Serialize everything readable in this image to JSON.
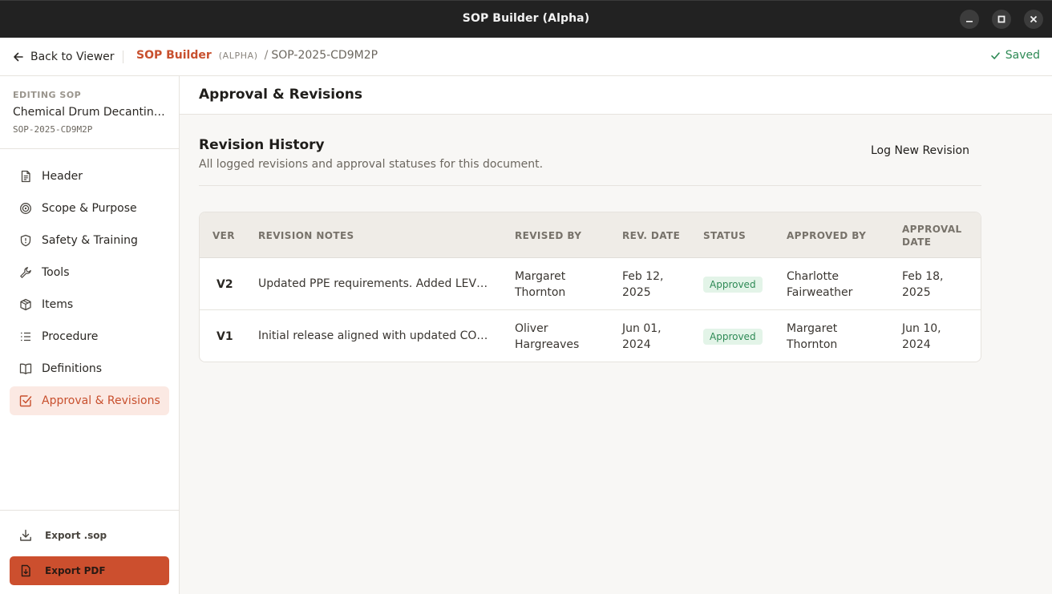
{
  "window": {
    "title": "SOP Builder (Alpha)"
  },
  "appbar": {
    "back_label": "Back to Viewer",
    "brand": "SOP Builder",
    "alpha": "(ALPHA)",
    "slash": "/",
    "doc_id": "SOP-2025-CD9M2P",
    "saved_label": "Saved"
  },
  "sidebar": {
    "editing_label": "EDITING SOP",
    "sop_name": "Chemical Drum Decanting a...",
    "sop_code": "SOP-2025-CD9M2P",
    "items": [
      {
        "label": "Header",
        "icon": "document-icon"
      },
      {
        "label": "Scope & Purpose",
        "icon": "target-icon"
      },
      {
        "label": "Safety & Training",
        "icon": "shield-icon"
      },
      {
        "label": "Tools",
        "icon": "wrench-icon"
      },
      {
        "label": "Items",
        "icon": "box-icon"
      },
      {
        "label": "Procedure",
        "icon": "list-icon"
      },
      {
        "label": "Definitions",
        "icon": "book-icon"
      },
      {
        "label": "Approval & Revisions",
        "icon": "check-square-icon",
        "active": true
      }
    ],
    "export_sop": "Export .sop",
    "export_pdf": "Export PDF"
  },
  "main": {
    "page_title": "Approval & Revisions",
    "section_title": "Revision History",
    "section_sub": "All logged revisions and approval statuses for this document.",
    "log_button": "Log New Revision",
    "columns": [
      "VER",
      "REVISION NOTES",
      "REVISED BY",
      "REV. DATE",
      "STATUS",
      "APPROVED BY",
      "APPROVAL DATE"
    ],
    "rows": [
      {
        "ver": "V2",
        "notes": "Updated PPE requirements. Added LEV reference and revised spill kit procedures.",
        "revised_by": "Margaret Thornton",
        "rev_date": "Feb 12, 2025",
        "status": "Approved",
        "approved_by": "Charlotte Fairweather",
        "approval_date": "Feb 18, 2025"
      },
      {
        "ver": "V1",
        "notes": "Initial release aligned with updated COSHH assessment.",
        "revised_by": "Oliver Hargreaves",
        "rev_date": "Jun 01, 2024",
        "status": "Approved",
        "approved_by": "Margaret Thornton",
        "approval_date": "Jun 10, 2024"
      }
    ]
  },
  "colors": {
    "accent": "#c8502e",
    "success": "#2e8a55",
    "titlebar": "#222222"
  }
}
